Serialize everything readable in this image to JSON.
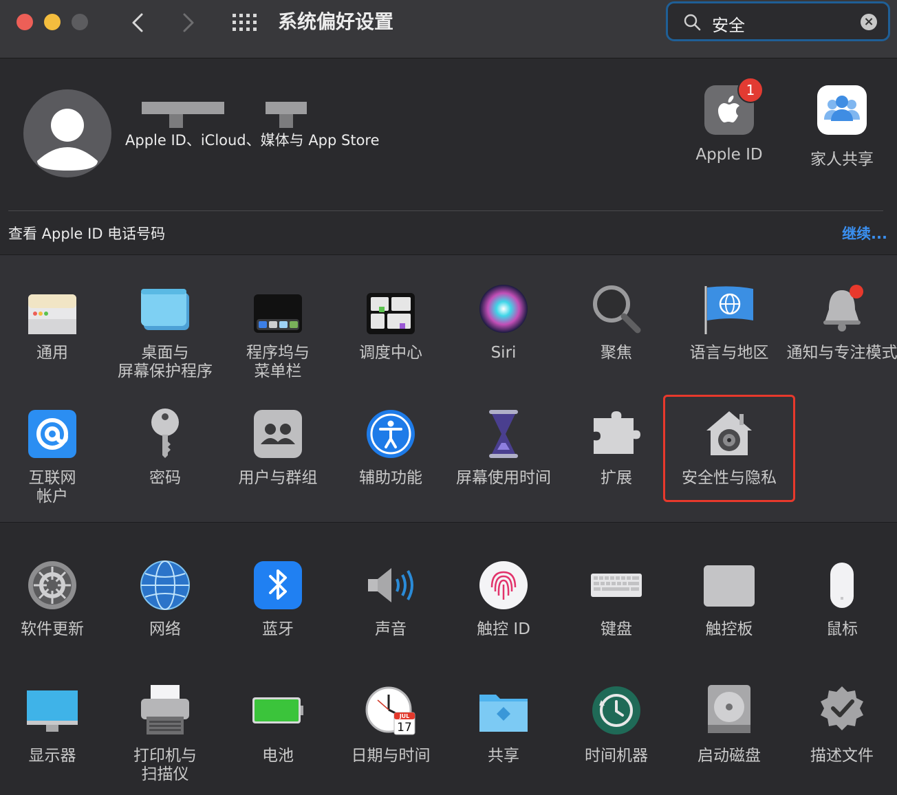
{
  "window": {
    "title": "系统偏好设置",
    "back_icon": "chevron-left-icon",
    "forward_icon": "chevron-right-icon",
    "grid_icon": "grid-icon"
  },
  "search": {
    "value": "安全",
    "icon": "search-icon",
    "clear_icon": "clear-icon"
  },
  "account": {
    "subtitle": "Apple ID、iCloud、媒体与 App Store"
  },
  "top_icons": [
    {
      "label": "Apple ID",
      "badge": "1"
    },
    {
      "label": "家人共享"
    }
  ],
  "notice": {
    "text": "查看 Apple ID 电话号码",
    "link": "继续..."
  },
  "colors": {
    "accent": "#3a8ff0",
    "highlight": "#e8392c",
    "badge": "#e23b32",
    "search_border": "#1f5f96"
  },
  "rows": [
    [
      {
        "label": "通用"
      },
      {
        "label": "桌面与\n屏幕保护程序"
      },
      {
        "label": "程序坞与\n菜单栏"
      },
      {
        "label": "调度中心"
      },
      {
        "label": "Siri"
      },
      {
        "label": "聚焦"
      },
      {
        "label": "语言与地区"
      },
      {
        "label": "通知与专注模式"
      }
    ],
    [
      {
        "label": "互联网\n帐户"
      },
      {
        "label": "密码"
      },
      {
        "label": "用户与群组"
      },
      {
        "label": "辅助功能"
      },
      {
        "label": "屏幕使用时间"
      },
      {
        "label": "扩展"
      },
      {
        "label": "安全性与隐私"
      }
    ],
    [
      {
        "label": "软件更新"
      },
      {
        "label": "网络"
      },
      {
        "label": "蓝牙"
      },
      {
        "label": "声音"
      },
      {
        "label": "触控 ID"
      },
      {
        "label": "键盘"
      },
      {
        "label": "触控板"
      },
      {
        "label": "鼠标"
      }
    ],
    [
      {
        "label": "显示器"
      },
      {
        "label": "打印机与\n扫描仪"
      },
      {
        "label": "电池"
      },
      {
        "label": "日期与时间",
        "calendar_month": "JUL",
        "calendar_day": "17"
      },
      {
        "label": "共享"
      },
      {
        "label": "时间机器"
      },
      {
        "label": "启动磁盘"
      },
      {
        "label": "描述文件"
      }
    ]
  ]
}
